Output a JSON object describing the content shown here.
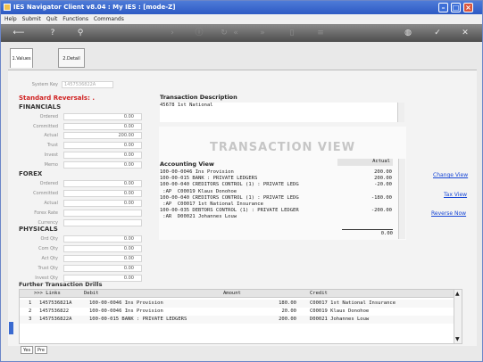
{
  "window": {
    "title": "IES Navigator Client v8.04 : My IES :     [mode-Z]"
  },
  "menu": [
    "Help",
    "Submit",
    "Quit",
    "Functions",
    "Commands"
  ],
  "toolbar_icons": [
    "back-icon",
    "help-icon",
    "search-icon",
    "next-icon",
    "info-icon",
    "refresh-icon",
    "first-icon",
    "last-icon",
    "copy-icon",
    "list-icon",
    "globe-icon",
    "check-icon",
    "close-icon"
  ],
  "tabs": [
    {
      "label": "1.Values"
    },
    {
      "label": "2.Detail"
    }
  ],
  "system_key": {
    "label": "System Key",
    "value": "1457536822A"
  },
  "standard_reversals": "Standard Reversals: .",
  "financials": {
    "title": "FINANCIALS",
    "rows": [
      {
        "label": "Ordered",
        "value": "0.00"
      },
      {
        "label": "Committed",
        "value": "0.00"
      },
      {
        "label": "Actual",
        "value": "200.00"
      },
      {
        "label": "Trust",
        "value": "0.00"
      },
      {
        "label": "Invest",
        "value": "0.00"
      },
      {
        "label": "Memo",
        "value": "0.00"
      }
    ]
  },
  "forex": {
    "title": "FOREX",
    "rows": [
      {
        "label": "Ordered",
        "value": "0.00"
      },
      {
        "label": "Committed",
        "value": "0.00"
      },
      {
        "label": "Actual",
        "value": "0.00"
      },
      {
        "label": "Forex Rate",
        "value": ""
      },
      {
        "label": "Currency",
        "value": ""
      }
    ]
  },
  "physicals": {
    "title": "PHYSICALS",
    "rows": [
      {
        "label": "Ord Qty",
        "value": "0.00"
      },
      {
        "label": "Com Qty",
        "value": "0.00"
      },
      {
        "label": "Act Qty",
        "value": "0.00"
      },
      {
        "label": "Trust Qty",
        "value": "0.00"
      },
      {
        "label": "Invest Qty",
        "value": "0.00"
      }
    ]
  },
  "transaction": {
    "label": "Transaction Description",
    "value": "45678 1st National"
  },
  "watermark": "TRANSACTION VIEW",
  "accounting": {
    "title": "Accounting View",
    "column": "Actual",
    "lines": [
      {
        "text": "100-00-0046 Ins Provision",
        "amount": "200.00"
      },
      {
        "text": "100-00-015 BANK : PRIVATE LEDGERS",
        "amount": "200.00"
      },
      {
        "text": "100-00-040 CREDITORS CONTROL (1) : PRIVATE LEDG",
        "amount": "-20.00"
      },
      {
        "text": " :AP  C00019 Klaus Donohoe",
        "amount": ""
      },
      {
        "text": "100-00-040 CREDITORS CONTROL (1) : PRIVATE LEDG",
        "amount": "-180.00"
      },
      {
        "text": " :AP  C00017 1st National Insurance",
        "amount": ""
      },
      {
        "text": "100-00-035 DEBTORS CONTROL (1) : PRIVATE LEDGER",
        "amount": "-200.00"
      },
      {
        "text": " :AR  D00021 Johannes Louw",
        "amount": ""
      }
    ],
    "total": "0.00"
  },
  "links": {
    "change_view": "Change View",
    "tax_view": "Tax View",
    "reverse_now": "Reverse Now"
  },
  "drills": {
    "title": "Further Transaction Drills",
    "headers": [
      ">>> Links",
      "Debit",
      "Amount",
      "Credit"
    ],
    "rows": [
      {
        "num": "1",
        "link": "1457536821A",
        "debit": "100-00-0046 Ins Provision",
        "amount": "180.00",
        "credit": "C00017 1st National Insurance"
      },
      {
        "num": "2",
        "link": "1457536822",
        "debit": "100-00-0046 Ins Provision",
        "amount": "20.00",
        "credit": "C00019 Klaus Donohoe"
      },
      {
        "num": "3",
        "link": "1457536822A",
        "debit": "100-00-015 BANK : PRIVATE LEDGERS",
        "amount": "200.00",
        "credit": "D00021 Johannes Louw"
      }
    ]
  },
  "bottom_tabs": [
    "Yes",
    "Pre"
  ]
}
